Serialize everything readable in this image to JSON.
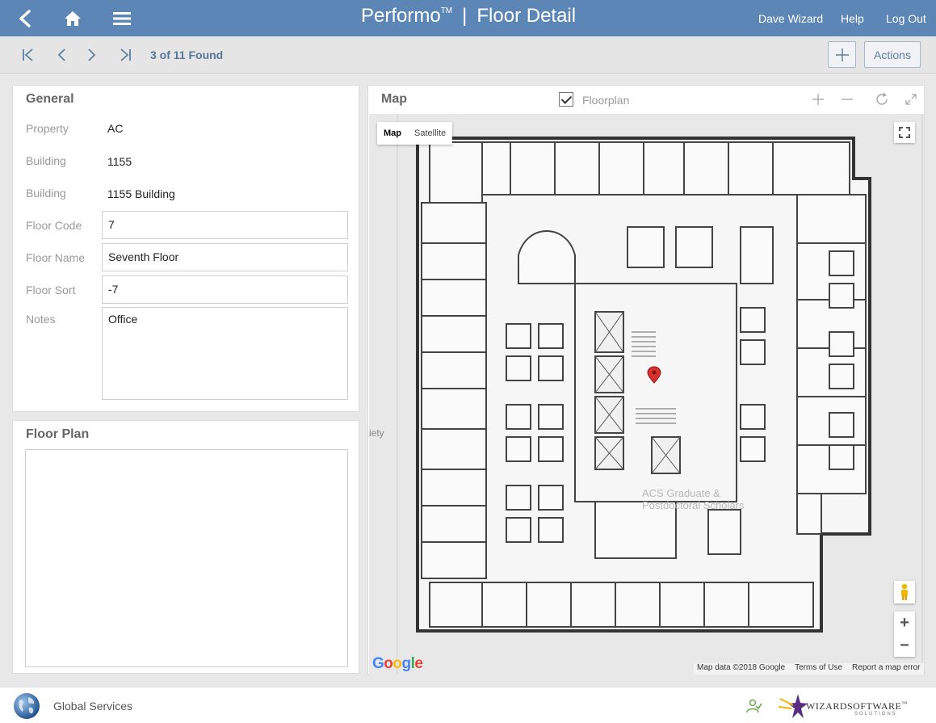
{
  "header": {
    "app_name": "Performo",
    "trademark": "TM",
    "separator": "|",
    "page_title": "Floor Detail",
    "user": "Dave Wizard",
    "help": "Help",
    "logout": "Log Out",
    "colors": {
      "bar": "#5b86b5"
    }
  },
  "toolbar": {
    "found_text": "3 of 11 Found",
    "actions_label": "Actions"
  },
  "general": {
    "title": "General",
    "fields": {
      "property_label": "Property",
      "property_value": "AC",
      "building_label": "Building",
      "building_value": "1155",
      "building_name_label": "Building",
      "building_name_value": "1155 Building",
      "floor_code_label": "Floor Code",
      "floor_code_value": "7",
      "floor_name_label": "Floor Name",
      "floor_name_value": "Seventh Floor",
      "floor_sort_label": "Floor Sort",
      "floor_sort_value": "-7",
      "notes_label": "Notes",
      "notes_value": "Office"
    }
  },
  "floor_plan": {
    "title": "Floor Plan"
  },
  "map": {
    "title": "Map",
    "floorplan_toggle_label": "Floorplan",
    "floorplan_checked": true,
    "map_type_map": "Map",
    "map_type_satellite": "Satellite",
    "poi_left": "iety",
    "watermark_line1": "ACS Graduate &",
    "watermark_line2": "Postdoctoral Scholars",
    "zoom_in": "+",
    "zoom_out": "−",
    "google_logo": "Google",
    "attribution": {
      "data": "Map data ©2018 Google",
      "terms": "Terms of Use",
      "report": "Report a map error"
    }
  },
  "footer": {
    "org": "Global Services",
    "brand_word": "WIZARDSOFTWARE",
    "brand_tm": "™",
    "brand_sub": "SOLUTIONS"
  }
}
